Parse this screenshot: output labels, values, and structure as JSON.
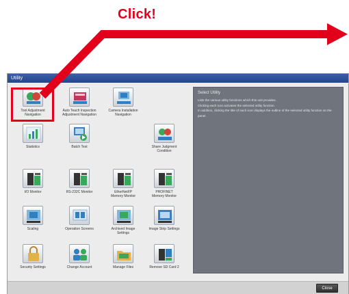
{
  "annotation": {
    "click_label": "Click!",
    "arrow_color": "#e3001b"
  },
  "window": {
    "title": "Utility",
    "close_label": "Close",
    "titlebar_color": "#2b4f97"
  },
  "tiles": [
    {
      "label": "Tool Adjustment\nNavigation",
      "icon": "balls-icon"
    },
    {
      "label": "Auto Teach Inspection\nAdjustment Navigation",
      "icon": "auto-teach-icon"
    },
    {
      "label": "Camera Installation\nNavigation",
      "icon": "camera-install-icon"
    },
    {
      "label": "Statistics",
      "icon": "chart-icon"
    },
    {
      "label": "Batch Test",
      "icon": "batch-test-icon"
    },
    {
      "label": "Share Judgment\nCondition",
      "icon": "share-judgment-icon"
    },
    {
      "label": "I/O Monitor",
      "icon": "io-monitor-icon"
    },
    {
      "label": "RS-232C Monitor",
      "icon": "rs232c-icon"
    },
    {
      "label": "EtherNet/IP\nMemory Monitor",
      "icon": "ethernet-ip-icon"
    },
    {
      "label": "PROFINET\nMemory Monitor",
      "icon": "profinet-icon"
    },
    {
      "label": "Scaling",
      "icon": "scaling-icon"
    },
    {
      "label": "Operation Screens",
      "icon": "operation-screens-icon"
    },
    {
      "label": "Archived Image\nSettings",
      "icon": "archived-image-icon"
    },
    {
      "label": "Image Strip Settings",
      "icon": "image-strip-icon"
    },
    {
      "label": "Security Settings",
      "icon": "lock-icon"
    },
    {
      "label": "Change Account",
      "icon": "users-icon"
    },
    {
      "label": "Manage Files",
      "icon": "folder-icon"
    },
    {
      "label": "Remove SD Card 2",
      "icon": "sd-card-icon"
    }
  ],
  "description": {
    "title": "Select Utility",
    "text": "Lists the various utility functions which this unit provides.\nClicking each icon activates the selected utility function.\nIn addition, clicking the title of each icon displays the outline of the selected utility function on the panel."
  }
}
